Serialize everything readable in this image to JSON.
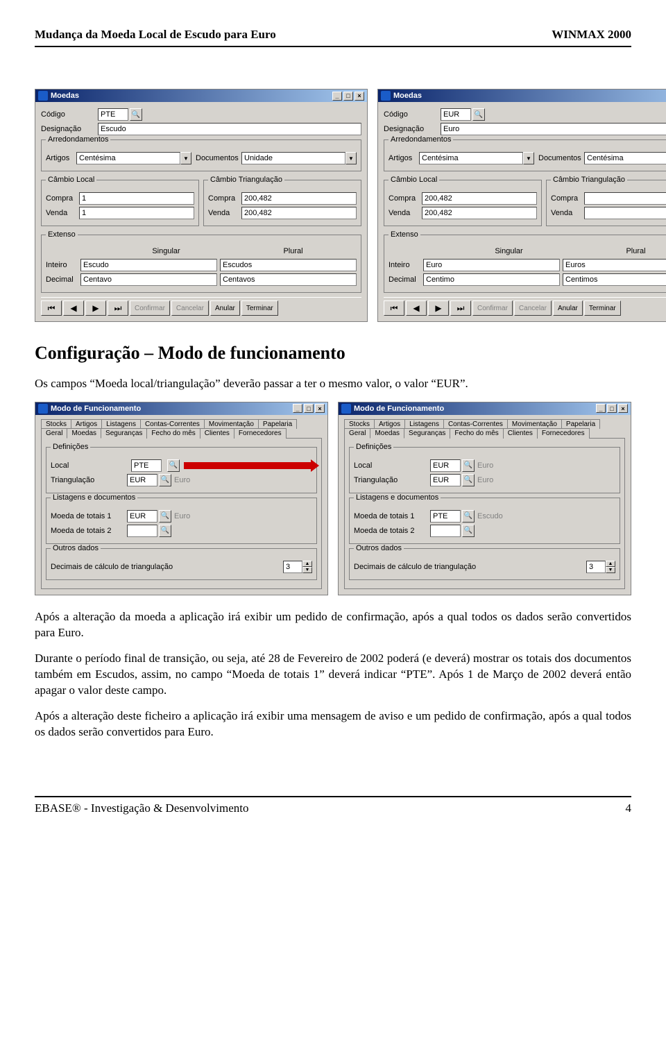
{
  "header": {
    "left": "Mudança da Moeda Local de Escudo para Euro",
    "right": "WINMAX 2000"
  },
  "moedas_pte": {
    "title": "Moedas",
    "code_label": "Código",
    "code": "PTE",
    "desig_label": "Designação",
    "desig": "Escudo",
    "group_round": "Arredondamentos",
    "artigos_label": "Artigos",
    "artigos": "Centésima",
    "documentos_label": "Documentos",
    "documentos": "Unidade",
    "group_cambio_local": "Câmbio Local",
    "group_cambio_tri": "Câmbio Triangulação",
    "compra_label": "Compra",
    "venda_label": "Venda",
    "local_compra": "1",
    "local_venda": "1",
    "tri_compra": "200,482",
    "tri_venda": "200,482",
    "group_extenso": "Extenso",
    "sing": "Singular",
    "plur": "Plural",
    "inteiro_label": "Inteiro",
    "decimal_label": "Decimal",
    "inteiro_s": "Escudo",
    "inteiro_p": "Escudos",
    "decimal_s": "Centavo",
    "decimal_p": "Centavos",
    "btns": {
      "confirmar": "Confirmar",
      "cancelar": "Cancelar",
      "anular": "Anular",
      "terminar": "Terminar"
    }
  },
  "moedas_eur": {
    "title": "Moedas",
    "code_label": "Código",
    "code": "EUR",
    "desig_label": "Designação",
    "desig": "Euro",
    "group_round": "Arredondamentos",
    "artigos_label": "Artigos",
    "artigos": "Centésima",
    "documentos_label": "Documentos",
    "documentos": "Centésima",
    "group_cambio_local": "Câmbio Local",
    "group_cambio_tri": "Câmbio Triangulação",
    "compra_label": "Compra",
    "venda_label": "Venda",
    "local_compra": "200,482",
    "local_venda": "200,482",
    "tri_compra": "",
    "tri_venda": "",
    "group_extenso": "Extenso",
    "sing": "Singular",
    "plur": "Plural",
    "inteiro_label": "Inteiro",
    "decimal_label": "Decimal",
    "inteiro_s": "Euro",
    "inteiro_p": "Euros",
    "decimal_s": "Centimo",
    "decimal_p": "Centimos",
    "btns": {
      "confirmar": "Confirmar",
      "cancelar": "Cancelar",
      "anular": "Anular",
      "terminar": "Terminar"
    }
  },
  "sect1_title": "Configuração – Modo de funcionamento",
  "sect1_p1": "Os campos “Moeda local/triangulação” deverão passar a ter o mesmo valor, o valor “EUR”.",
  "modo_tabs_top": [
    "Stocks",
    "Artigos",
    "Listagens",
    "Contas-Correntes",
    "Movimentação",
    "Papelaria"
  ],
  "modo_tabs_bot": [
    "Geral",
    "Moedas",
    "Seguranças",
    "Fecho do mês",
    "Clientes",
    "Fornecedores"
  ],
  "modo_left": {
    "title": "Modo de Funcionamento",
    "def_group": "Definições",
    "local_label": "Local",
    "local": "PTE",
    "local_ghost": "",
    "tri_label": "Triangulação",
    "tri": "EUR",
    "tri_ghost": "Euro",
    "list_group": "Listagens e documentos",
    "mt1_label": "Moeda de totais 1",
    "mt1": "EUR",
    "mt1_ghost": "Euro",
    "mt2_label": "Moeda de totais 2",
    "mt2": "",
    "out_group": "Outros dados",
    "dec_label": "Decimais de cálculo de triangulação",
    "dec": "3"
  },
  "modo_right": {
    "title": "Modo de Funcionamento",
    "def_group": "Definições",
    "local_label": "Local",
    "local": "EUR",
    "local_ghost": "Euro",
    "tri_label": "Triangulação",
    "tri": "EUR",
    "tri_ghost": "Euro",
    "list_group": "Listagens e documentos",
    "mt1_label": "Moeda de totais 1",
    "mt1": "PTE",
    "mt1_ghost": "Escudo",
    "mt2_label": "Moeda de totais 2",
    "mt2": "",
    "out_group": "Outros dados",
    "dec_label": "Decimais de cálculo de triangulação",
    "dec": "3"
  },
  "p_after1": "Após a alteração da moeda a aplicação irá exibir um pedido de confirmação, após a qual todos os dados serão convertidos para Euro.",
  "p_after2": "Durante o período final de transição, ou seja, até 28 de Fevereiro de 2002 poderá (e deverá) mostrar os totais dos documentos também em Escudos, assim, no campo “Moeda de totais 1” deverá indicar “PTE”. Após 1 de Março de 2002 deverá então apagar o valor deste campo.",
  "p_after3": "Após a alteração deste ficheiro a aplicação irá exibir uma mensagem de aviso e um pedido de confirmação, após a qual todos os dados serão convertidos para Euro.",
  "footer": {
    "left": "EBASE® - Investigação & Desenvolvimento",
    "right": "4"
  }
}
